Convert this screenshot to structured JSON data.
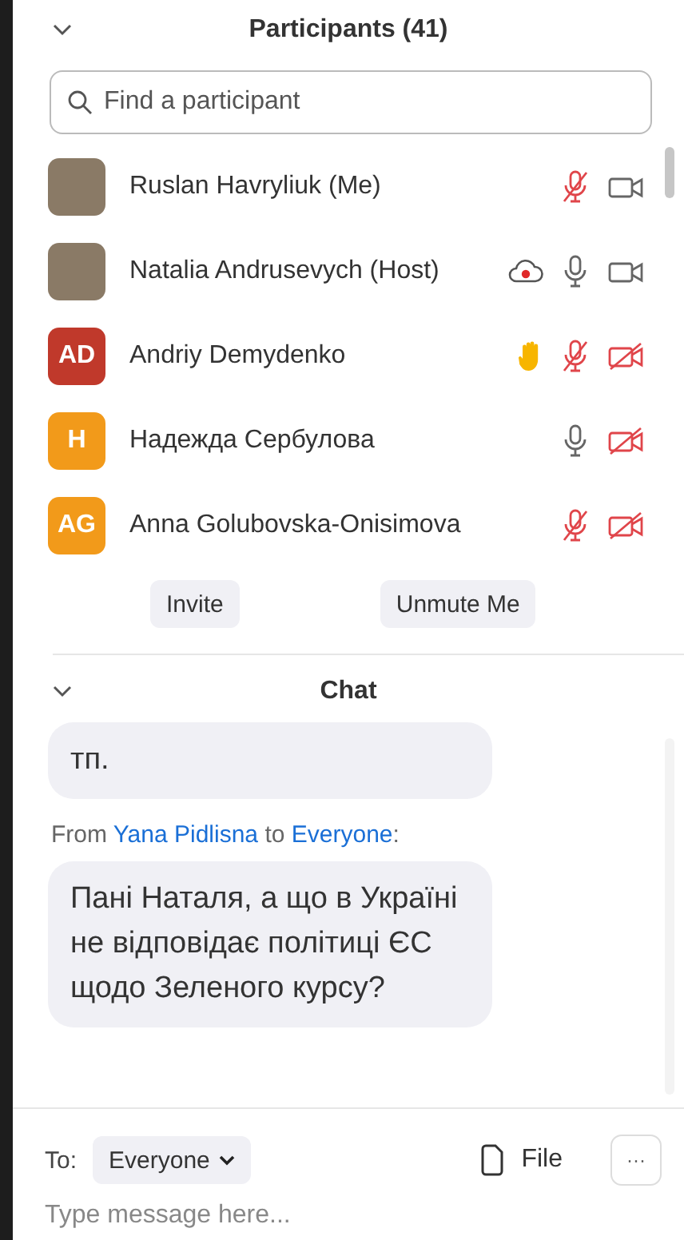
{
  "participants_panel": {
    "title": "Participants (41)",
    "search": {
      "placeholder": "Find a participant"
    },
    "participants": [
      {
        "name": "Ruslan Havryliuk (Me)",
        "avatar": {
          "kind": "photo"
        },
        "hand_raised": false,
        "recording": false,
        "mic_muted": true,
        "video_off": false
      },
      {
        "name": "Natalia Andrusevych (Host)",
        "avatar": {
          "kind": "photo"
        },
        "hand_raised": false,
        "recording": true,
        "mic_muted": false,
        "video_off": false
      },
      {
        "name": "Andriy Demydenko",
        "avatar": {
          "kind": "initials",
          "initials": "AD",
          "color": "#c0392b"
        },
        "hand_raised": true,
        "recording": false,
        "mic_muted": true,
        "video_off": true
      },
      {
        "name": "Надежда Сербулова",
        "avatar": {
          "kind": "initials",
          "initials": "H",
          "color": "#f29a1a"
        },
        "hand_raised": false,
        "recording": false,
        "mic_muted": false,
        "video_off": true
      },
      {
        "name": "Anna Golubovska-Onisimova",
        "avatar": {
          "kind": "initials",
          "initials": "AG",
          "color": "#f29a1a"
        },
        "hand_raised": false,
        "recording": false,
        "mic_muted": true,
        "video_off": true
      }
    ],
    "buttons": [
      "Invite",
      "Unmute Me"
    ]
  },
  "chat_panel": {
    "title": "Chat",
    "messages": [
      {
        "text": "тп."
      },
      {
        "header": {
          "from_label": "From",
          "sender": "Yana Pidlisna",
          "to_label": "to",
          "recipient": "Everyone",
          "colon": ":"
        },
        "text": "Пані Наталя, а що в Україні не відповідає політиці ЄС щодо Зеленого курсу?"
      }
    ],
    "to_label": "To:",
    "recipient": "Everyone",
    "file_label": "File",
    "more_label": "···",
    "input": {
      "placeholder": "Type message here..."
    }
  }
}
